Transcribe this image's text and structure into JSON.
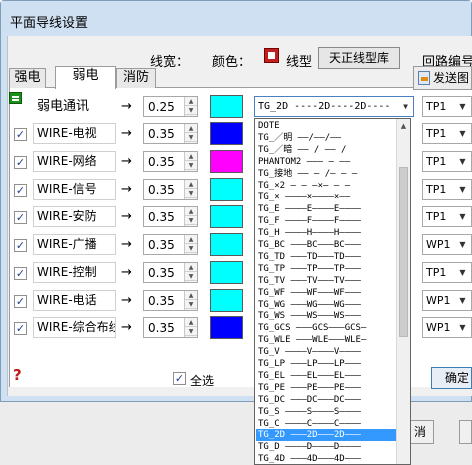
{
  "window": {
    "title": "平面导线设置"
  },
  "header": {
    "line_width_label": "线宽：",
    "color_label": "颜色：",
    "line_type_label": "线型",
    "std_line_lib_button": "天正线型库",
    "circuit_no_label": "回路编号"
  },
  "tabs": [
    {
      "label": "强电",
      "active": false
    },
    {
      "label": "弱电",
      "active": true
    },
    {
      "label": "消防",
      "active": false
    }
  ],
  "send_button": "发送图",
  "rows": [
    {
      "checked": null,
      "name": "弱电通讯",
      "width": "0.25",
      "color": "#00ffff",
      "linetype": "TG_2D ----2D----2D----",
      "circuit": "TP1"
    },
    {
      "checked": true,
      "name": "WIRE-电视",
      "width": "0.35",
      "color": "#0000ff",
      "linetype": "",
      "circuit": "TP1"
    },
    {
      "checked": true,
      "name": "WIRE-网络",
      "width": "0.35",
      "color": "#ff00ff",
      "linetype": "",
      "circuit": "TP1"
    },
    {
      "checked": true,
      "name": "WIRE-信号",
      "width": "0.35",
      "color": "#00ffff",
      "linetype": "",
      "circuit": "TP1"
    },
    {
      "checked": true,
      "name": "WIRE-安防",
      "width": "0.35",
      "color": "#00ffff",
      "linetype": "",
      "circuit": "TP1"
    },
    {
      "checked": true,
      "name": "WIRE-广播",
      "width": "0.35",
      "color": "#00ffff",
      "linetype": "",
      "circuit": "WP1"
    },
    {
      "checked": true,
      "name": "WIRE-控制",
      "width": "0.35",
      "color": "#00ffff",
      "linetype": "",
      "circuit": "TP1"
    },
    {
      "checked": true,
      "name": "WIRE-电话",
      "width": "0.35",
      "color": "#00ffff",
      "linetype": "",
      "circuit": "WP1"
    },
    {
      "checked": true,
      "name": "WIRE-综合布线",
      "width": "0.35",
      "color": "#0000ff",
      "linetype": "",
      "circuit": "WP1"
    }
  ],
  "row_arrow": "→",
  "select_all": {
    "checked": true,
    "label": "全选"
  },
  "ok_button": "确定",
  "cancel_button_behind": "消",
  "dropdown": {
    "selected_index": 26,
    "items": [
      "DOTE",
      "TG_／明 ——/——/——",
      "TG_／暗 —— / —— /",
      "PHANTOM2 ——— — ——",
      "TG_接地 —— — /— — —",
      "TG_×2 — — —×— — —",
      "TG_× ————×————×——",
      "TG_E ————E————E————",
      "TG_F ————F————F————",
      "TG_H ————H————H————",
      "TG_BC ———BC———BC———",
      "TG_TD ———TD———TD———",
      "TG_TP ———TP———TP———",
      "TG_TV ———TV———TV———",
      "TG_WF ———WF———WF———",
      "TG_WG ———WG———WG———",
      "TG_WS ———WS———WS———",
      "TG_GCS ———GCS———GCS—",
      "TG_WLE ———WLE———WLE—",
      "TG_V ————V————V————",
      "TG_LP ———LP———LP———",
      "TG_EL ———EL———EL———",
      "TG_PE ———PE———PE———",
      "TG_DC ———DC———DC———",
      "TG_S ————S————S————",
      "TG_C ————C————C————",
      "TG_2D ———2D———2D———",
      "TG_D ————D————D————",
      "TG_4D ———4D———4D———"
    ]
  },
  "icons": {
    "color_swatch": "color-swatch-icon",
    "layer": "layer-icon",
    "send": "send-icon",
    "help": "?"
  }
}
